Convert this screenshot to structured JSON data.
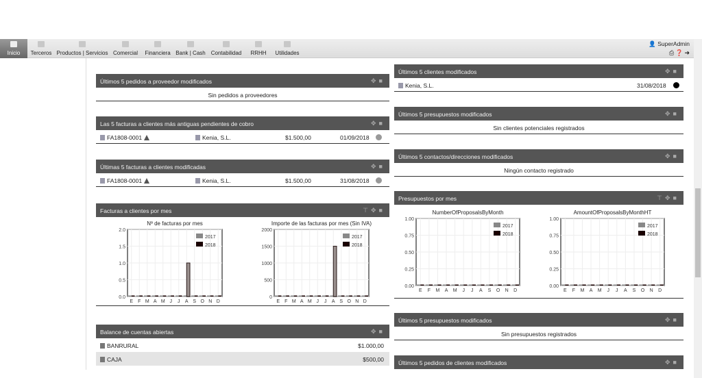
{
  "menu": [
    {
      "label": "Inicio",
      "active": true
    },
    {
      "label": "Terceros"
    },
    {
      "label": "Productos | Servicios"
    },
    {
      "label": "Comercial"
    },
    {
      "label": "Financiera"
    },
    {
      "label": "Bank | Cash"
    },
    {
      "label": "Contabilidad"
    },
    {
      "label": "RRHH"
    },
    {
      "label": "Utilidades"
    }
  ],
  "user": {
    "name": "SuperAdmin",
    "icons": [
      "print-icon",
      "help-icon",
      "logout-icon"
    ]
  },
  "left": {
    "p1": {
      "title": "Últimos 5 pedidos a proveedor modificados",
      "empty": "Sin pedidos a proveedores"
    },
    "p2": {
      "title": "Las 5 facturas a clientes más antiguas pendientes de cobro",
      "ref": "FA1808-0001",
      "client": "Kenia, S.L.",
      "amount": "$1.500,00",
      "date": "01/09/2018"
    },
    "p3": {
      "title": "Últimas 5 facturas a clientes modificadas",
      "ref": "FA1808-0001",
      "client": "Kenia, S.L.",
      "amount": "$1.500,00",
      "date": "31/08/2018"
    },
    "p4": {
      "title": "Facturas a clientes por mes"
    },
    "p5": {
      "title": "Balance de cuentas abiertas",
      "rows": [
        {
          "name": "BANRURAL",
          "amount": "$1.000,00"
        },
        {
          "name": "CAJA",
          "amount": "$500,00"
        }
      ]
    }
  },
  "right": {
    "p1": {
      "title": "Últimos 5 clientes modificados",
      "client": "Kenia, S.L.",
      "date": "31/08/2018"
    },
    "p2": {
      "title": "Últimos 5 presupuestos modificados",
      "empty": "Sin clientes potenciales registrados"
    },
    "p3": {
      "title": "Últimos 5 contactos/direcciones modificados",
      "empty": "Ningún contacto registrado"
    },
    "p4": {
      "title": "Presupuestos por mes"
    },
    "p5": {
      "title": "Últimos 5 presupuestos modificados",
      "empty": "Sin presupuestos registrados"
    },
    "p6": {
      "title": "Últimos 5 pedidos de clientes modificados"
    }
  },
  "chart_data": [
    {
      "type": "bar",
      "title": "Nº de facturas por mes",
      "categories": [
        "E",
        "F",
        "M",
        "A",
        "M",
        "J",
        "J",
        "A",
        "S",
        "O",
        "N",
        "D"
      ],
      "ylim": [
        0,
        2
      ],
      "yticks": [
        "0.0",
        "0.5",
        "1.0",
        "1.5",
        "2.0"
      ],
      "series": [
        {
          "name": "2017",
          "color": "#888888",
          "values": [
            0,
            0,
            0,
            0,
            0,
            0,
            0,
            0,
            0,
            0,
            0,
            0
          ]
        },
        {
          "name": "2018",
          "color": "#1a0000",
          "values": [
            0,
            0,
            0,
            0,
            0,
            0,
            0,
            1,
            0,
            0,
            0,
            0
          ]
        }
      ],
      "legend": "top-right"
    },
    {
      "type": "bar",
      "title": "Importe de las facturas por mes (Sin IVA)",
      "categories": [
        "E",
        "F",
        "M",
        "A",
        "M",
        "J",
        "J",
        "A",
        "S",
        "O",
        "N",
        "D"
      ],
      "ylim": [
        0,
        2000
      ],
      "yticks": [
        "0",
        "500",
        "1000",
        "1500",
        "2000"
      ],
      "series": [
        {
          "name": "2017",
          "color": "#888888",
          "values": [
            0,
            0,
            0,
            0,
            0,
            0,
            0,
            0,
            0,
            0,
            0,
            0
          ]
        },
        {
          "name": "2018",
          "color": "#1a0000",
          "values": [
            0,
            0,
            0,
            0,
            0,
            0,
            0,
            1500,
            0,
            0,
            0,
            0
          ]
        }
      ],
      "legend": "top-right"
    },
    {
      "type": "bar",
      "title": "NumberOfProposalsByMonth",
      "categories": [
        "E",
        "F",
        "M",
        "A",
        "M",
        "J",
        "J",
        "A",
        "S",
        "O",
        "N",
        "D"
      ],
      "ylim": [
        0,
        1
      ],
      "yticks": [
        "0.00",
        "0.25",
        "0.50",
        "0.75",
        "1.00"
      ],
      "series": [
        {
          "name": "2017",
          "color": "#888888",
          "values": [
            0,
            0,
            0,
            0,
            0,
            0,
            0,
            0,
            0,
            0,
            0,
            0
          ]
        },
        {
          "name": "2018",
          "color": "#1a0000",
          "values": [
            0,
            0,
            0,
            0,
            0,
            0,
            0,
            0,
            0,
            0,
            0,
            0
          ]
        }
      ],
      "legend": "top-right"
    },
    {
      "type": "bar",
      "title": "AmountOfProposalsByMonthHT",
      "categories": [
        "E",
        "F",
        "M",
        "A",
        "M",
        "J",
        "J",
        "A",
        "S",
        "O",
        "N",
        "D"
      ],
      "ylim": [
        0,
        1
      ],
      "yticks": [
        "0.00",
        "0.25",
        "0.50",
        "0.75",
        "1.00"
      ],
      "series": [
        {
          "name": "2017",
          "color": "#888888",
          "values": [
            0,
            0,
            0,
            0,
            0,
            0,
            0,
            0,
            0,
            0,
            0,
            0
          ]
        },
        {
          "name": "2018",
          "color": "#1a0000",
          "values": [
            0,
            0,
            0,
            0,
            0,
            0,
            0,
            0,
            0,
            0,
            0,
            0
          ]
        }
      ],
      "legend": "top-right"
    }
  ]
}
